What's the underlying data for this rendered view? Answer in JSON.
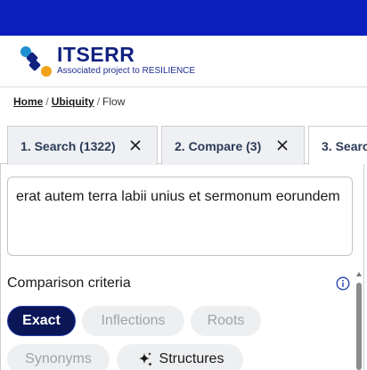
{
  "colors": {
    "topbar": "#0b1fbf",
    "brand": "#10217f",
    "chip_selected": "#0a1656",
    "logo_blue": "#1f8fd0",
    "logo_orange": "#f2a31b"
  },
  "logo": {
    "title": "ITSERR",
    "subtitle": "Associated project to RESILIENCE"
  },
  "breadcrumb": {
    "items": [
      {
        "label": "Home",
        "link": true
      },
      {
        "label": "Ubiquity",
        "link": true
      },
      {
        "label": "Flow",
        "link": false
      }
    ],
    "separator": "/"
  },
  "tabs": [
    {
      "label": "1. Search (1322)",
      "close_icon": "close-icon"
    },
    {
      "label": "2. Compare (3)",
      "close_icon": "close-icon"
    },
    {
      "label": "3. Searc"
    }
  ],
  "query": {
    "text": "erat autem terra labii unius et sermonum eorundem"
  },
  "criteria": {
    "title": "Comparison criteria",
    "info_icon": "info-icon",
    "options": [
      {
        "label": "Exact",
        "selected": true
      },
      {
        "label": "Inflections",
        "selected": false
      },
      {
        "label": "Roots",
        "selected": false
      },
      {
        "label": "Synonyms",
        "selected": false
      },
      {
        "label": "Structures",
        "selected": false,
        "icon": "sparkle-icon"
      }
    ]
  }
}
